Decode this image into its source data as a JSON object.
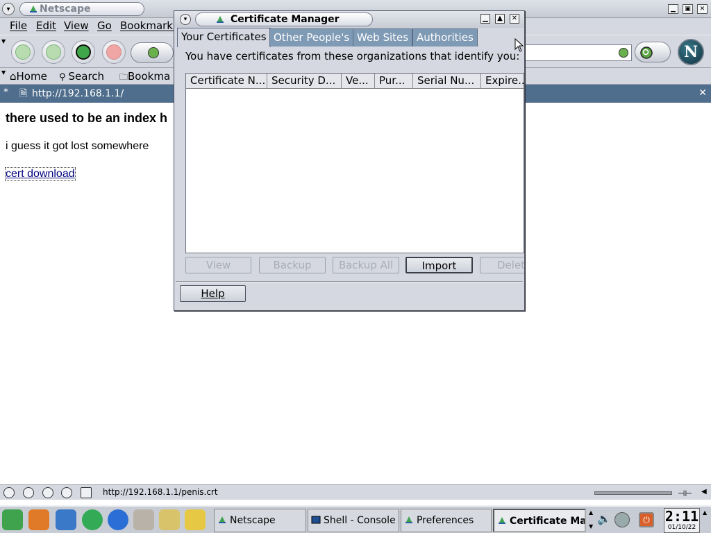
{
  "browser": {
    "title": "Netscape",
    "menu": [
      "File",
      "Edit",
      "View",
      "Go",
      "Bookmarks"
    ],
    "personal_toolbar": {
      "home": "Home",
      "search": "Search",
      "bookmarks": "Bookma"
    },
    "tab": {
      "url": "http://192.168.1.1/"
    },
    "page": {
      "heading": "there used to be an index h",
      "paragraph": "i guess it got lost somewhere",
      "link": "cert download"
    },
    "status_url": "http://192.168.1.1/penis.crt"
  },
  "certificate_manager": {
    "title": "Certificate Manager",
    "tabs": [
      "Your Certificates",
      "Other People's",
      "Web Sites",
      "Authorities"
    ],
    "active_tab": "Your Certificates",
    "description": "You have certificates from these organizations that identify you:",
    "columns": [
      "Certificate N...",
      "Security D...",
      "Ve...",
      "Pur...",
      "Serial Nu...",
      "Expire..."
    ],
    "rows": [],
    "buttons": {
      "view": "View",
      "backup": "Backup",
      "backup_all": "Backup All",
      "import": "Import",
      "delete": "Delet"
    },
    "help": "Help"
  },
  "taskbar": {
    "tasks": [
      "Netscape",
      "Shell - Console",
      "Preferences",
      "Certificate Man"
    ],
    "clock_time": "2:11",
    "clock_date": "01/10/22"
  },
  "colors": {
    "tab_bar": "#4f6d8c",
    "inactive_tab": "#7f9ab5",
    "link": "#000080",
    "window_bg": "#d5d8e0"
  }
}
